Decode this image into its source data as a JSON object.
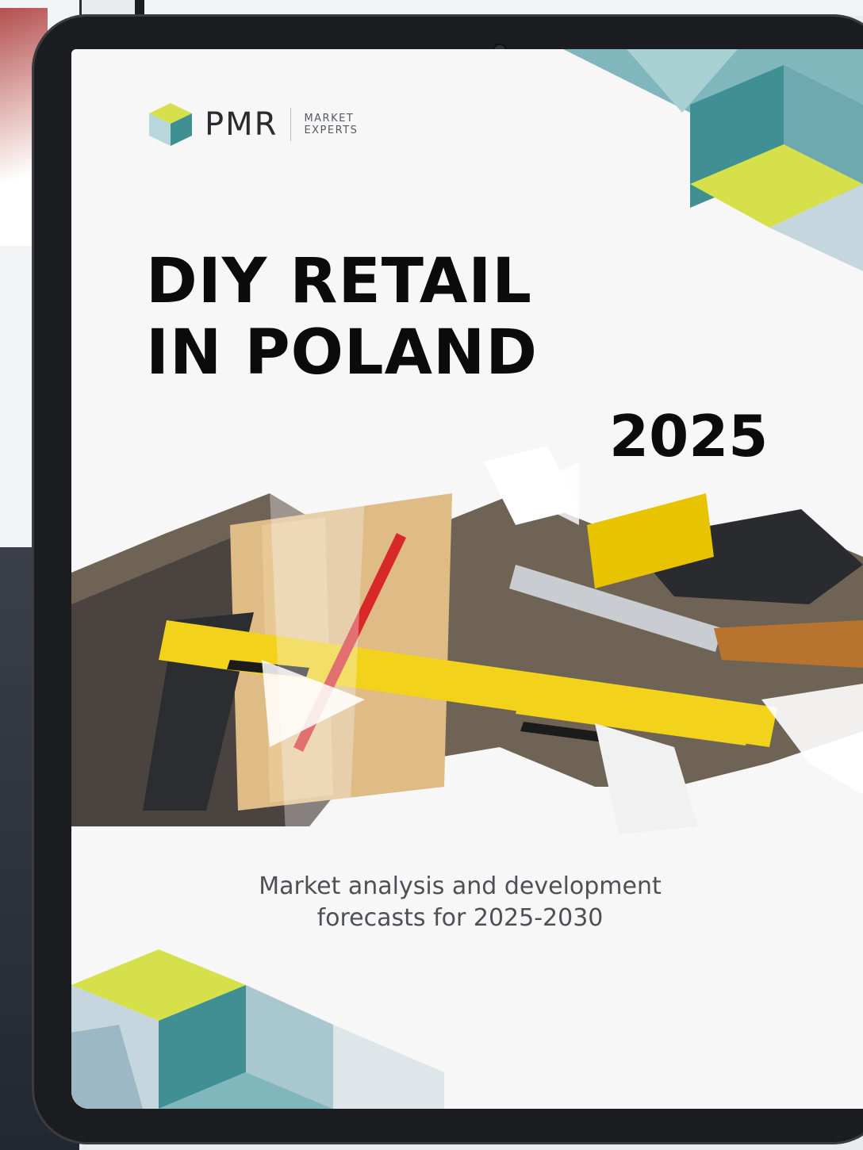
{
  "cover": {
    "logo": {
      "wordmark": "PMR",
      "tagline_line1": "MARKET",
      "tagline_line2": "EXPERTS"
    },
    "title_line1": "DIY RETAIL",
    "title_line2": "IN POLAND",
    "year": "2025",
    "subtitle_line1": "Market analysis and development",
    "subtitle_line2": "forecasts for 2025-2030"
  },
  "colors": {
    "teal": "#3f8f93",
    "lime": "#d6e04a",
    "pale_blue": "#c6d6df",
    "ruler_yellow": "#f2d21b",
    "wood": "#d9b27a"
  },
  "icons": {
    "logo_mark": "cube-logo-icon",
    "camera": "front-camera-icon"
  }
}
